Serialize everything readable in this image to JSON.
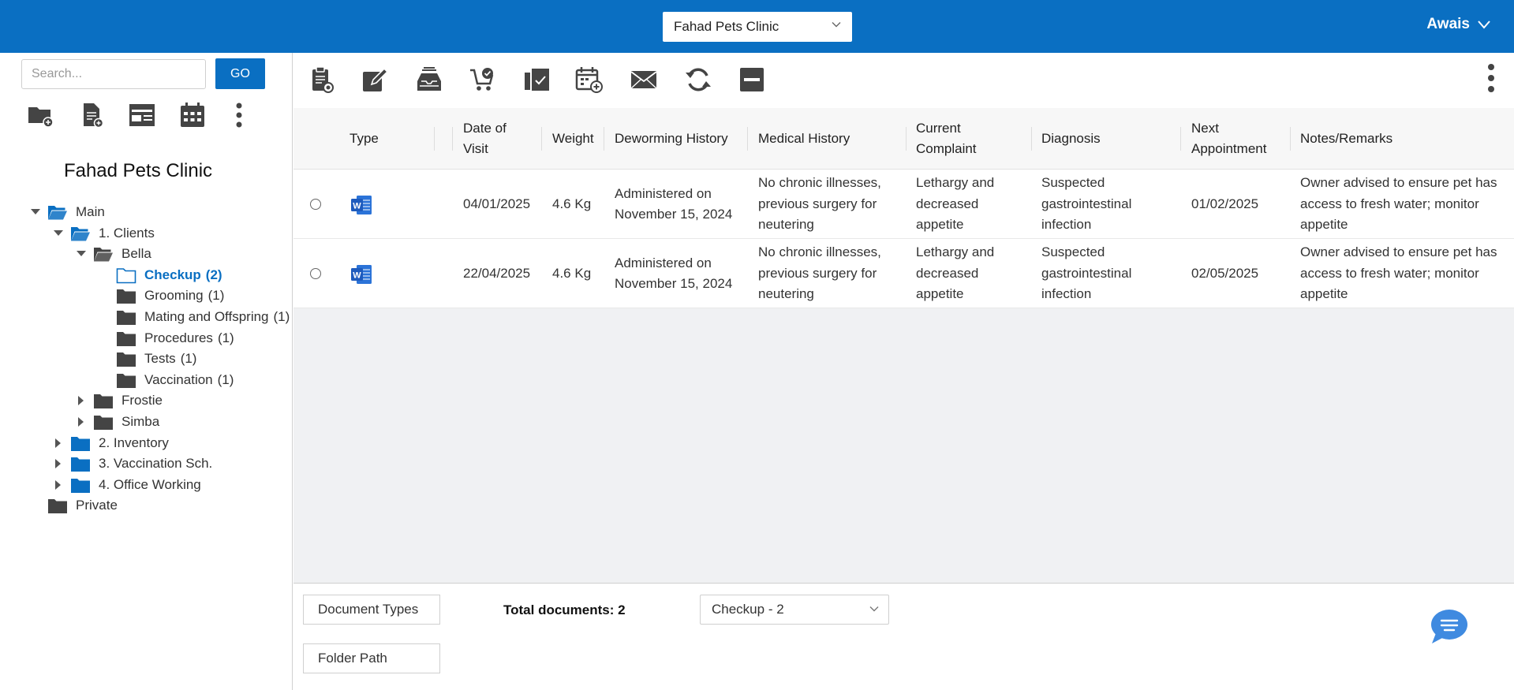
{
  "header": {
    "org_selector": "Fahad Pets Clinic",
    "user_name": "Awais"
  },
  "sidebar": {
    "search_placeholder": "Search...",
    "go_label": "GO",
    "clinic_title": "Fahad Pets Clinic",
    "icons": [
      "new-folder-icon",
      "new-document-icon",
      "form-icon",
      "calendar-icon",
      "more-vertical-icon"
    ],
    "tree": [
      {
        "label": "Main",
        "count": "",
        "level": 0,
        "expanded": true,
        "color": "#0a6fc2"
      },
      {
        "label": "1. Clients",
        "count": "",
        "level": 1,
        "expanded": true,
        "color": "#0a6fc2"
      },
      {
        "label": "Bella",
        "count": "",
        "level": 2,
        "expanded": true,
        "color": "#444"
      },
      {
        "label": "Checkup",
        "count": "(2)",
        "level": 3,
        "active": true,
        "color": "#0a6fc2"
      },
      {
        "label": "Grooming",
        "count": "(1)",
        "level": 3,
        "color": "#444"
      },
      {
        "label": "Mating and Offspring",
        "count": "(1)",
        "level": 3,
        "color": "#444"
      },
      {
        "label": "Procedures",
        "count": "(1)",
        "level": 3,
        "color": "#444"
      },
      {
        "label": "Tests",
        "count": "(1)",
        "level": 3,
        "color": "#444"
      },
      {
        "label": "Vaccination",
        "count": "(1)",
        "level": 3,
        "color": "#444"
      },
      {
        "label": "Frostie",
        "count": "",
        "level": 2,
        "collapsed": true,
        "color": "#444"
      },
      {
        "label": "Simba",
        "count": "",
        "level": 2,
        "collapsed": true,
        "color": "#444"
      },
      {
        "label": "2. Inventory",
        "count": "",
        "level": 1,
        "collapsed": true,
        "color": "#0a6fc2"
      },
      {
        "label": "3. Vaccination Sch.",
        "count": "",
        "level": 1,
        "collapsed": true,
        "color": "#0a6fc2"
      },
      {
        "label": "4. Office Working",
        "count": "",
        "level": 1,
        "collapsed": true,
        "color": "#0a6fc2"
      },
      {
        "label": "Private",
        "count": "",
        "level": 0,
        "color": "#444"
      }
    ]
  },
  "toolbar": {
    "icons": [
      "clipboard-icon",
      "edit-icon",
      "inbox-icon",
      "cart-check-icon",
      "documents-check-icon",
      "calendar-add-icon",
      "email-icon",
      "refresh-icon",
      "minus-box-icon",
      "more-vertical-icon"
    ]
  },
  "table": {
    "columns": [
      "Type",
      "Date of Visit",
      "Weight",
      "Deworming History",
      "Medical History",
      "Current Complaint",
      "Diagnosis",
      "Next Appointment",
      "Notes/Remarks"
    ],
    "rows": [
      {
        "type_icon": "word-doc-icon",
        "date": "04/01/2025",
        "weight": "4.6 Kg",
        "deworming": "Administered on November 15, 2024",
        "medical": "No chronic illnesses, previous surgery for neutering",
        "complaint": "Lethargy and decreased appetite",
        "diagnosis": "Suspected gastrointestinal infection",
        "next": "01/02/2025",
        "notes": "Owner advised to ensure pet has access to fresh water; monitor appetite"
      },
      {
        "type_icon": "word-doc-icon",
        "date": "22/04/2025",
        "weight": "4.6 Kg",
        "deworming": "Administered on November 15, 2024",
        "medical": "No chronic illnesses, previous surgery for neutering",
        "complaint": "Lethargy and decreased appetite",
        "diagnosis": "Suspected gastrointestinal infection",
        "next": "02/05/2025",
        "notes": "Owner advised to ensure pet has access to fresh water; monitor appetite"
      }
    ]
  },
  "footer": {
    "document_types_label": "Document Types",
    "folder_path_label": "Folder Path",
    "total_docs": "Total documents: 2",
    "folder_select": "Checkup - 2"
  },
  "colors": {
    "brand": "#0a6fc2",
    "folder_dark": "#444444",
    "word_blue": "#1e5bbd"
  }
}
